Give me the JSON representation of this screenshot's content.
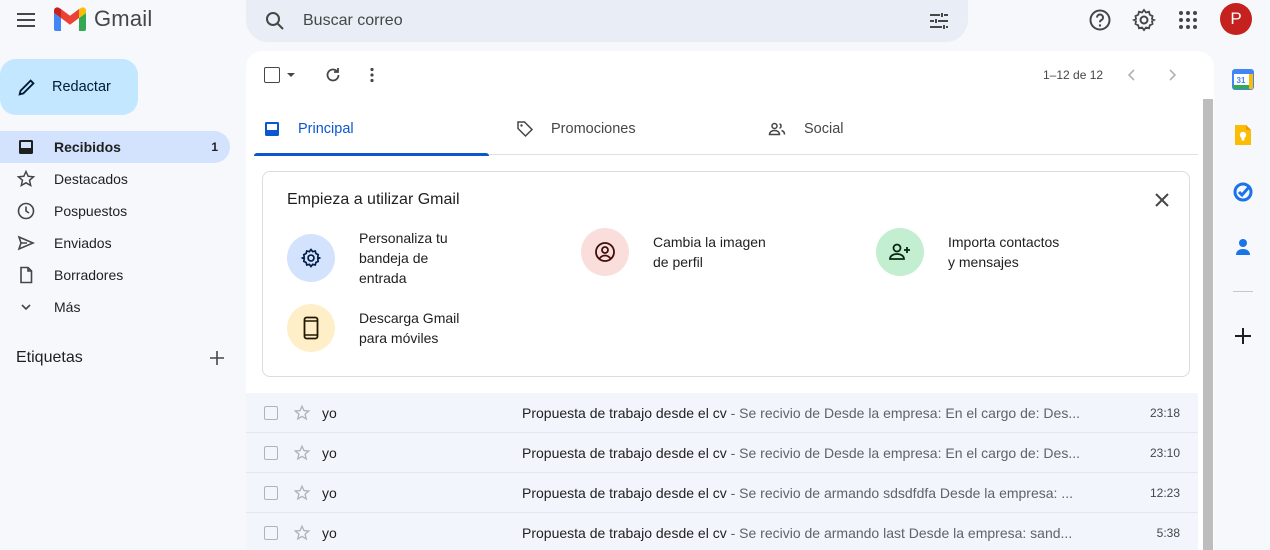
{
  "app": {
    "logo_text": "Gmail"
  },
  "search": {
    "placeholder": "Buscar correo"
  },
  "account": {
    "avatar_letter": "P"
  },
  "compose": {
    "label": "Redactar"
  },
  "nav": {
    "items": [
      {
        "label": "Recibidos",
        "count": "1",
        "icon": "inbox-icon"
      },
      {
        "label": "Destacados",
        "count": "",
        "icon": "star-icon"
      },
      {
        "label": "Pospuestos",
        "count": "",
        "icon": "clock-icon"
      },
      {
        "label": "Enviados",
        "count": "",
        "icon": "send-icon"
      },
      {
        "label": "Borradores",
        "count": "",
        "icon": "draft-icon"
      },
      {
        "label": "Más",
        "count": "",
        "icon": "chevron-down-icon"
      }
    ],
    "labels_title": "Etiquetas"
  },
  "toolbar": {
    "pager": "1–12 de 12"
  },
  "tabs": [
    {
      "label": "Principal",
      "active": true
    },
    {
      "label": "Promociones",
      "active": false
    },
    {
      "label": "Social",
      "active": false
    }
  ],
  "getting_started": {
    "title": "Empieza a utilizar Gmail",
    "tips": [
      {
        "text": "Personaliza tu\nbandeja de\nentrada",
        "icon": "settings-icon",
        "color": "#d3e3fd"
      },
      {
        "text": "Cambia la imagen\nde perfil",
        "icon": "account-circle-icon",
        "color": "#f9dedc"
      },
      {
        "text": "Importa contactos\ny mensajes",
        "icon": "person-add-icon",
        "color": "#c4eed0"
      },
      {
        "text": "Descarga Gmail\npara móviles",
        "icon": "phone-icon",
        "color": "#ffefc9"
      }
    ]
  },
  "emails": [
    {
      "from": "yo",
      "subject": "Propuesta de trabajo desde el cv",
      "snippet": " - Se recivio de Desde la empresa: En el cargo de: Des...",
      "time": "23:18"
    },
    {
      "from": "yo",
      "subject": "Propuesta de trabajo desde el cv",
      "snippet": " - Se recivio de Desde la empresa: En el cargo de: Des...",
      "time": "23:10"
    },
    {
      "from": "yo",
      "subject": "Propuesta de trabajo desde el cv",
      "snippet": " - Se recivio de armando sdsdfdfa Desde la empresa: ...",
      "time": "12:23"
    },
    {
      "from": "yo",
      "subject": "Propuesta de trabajo desde el cv",
      "snippet": " - Se recivio de armando last Desde la empresa: sand...",
      "time": "5:38"
    }
  ],
  "colors": {
    "accent": "#0b57d0",
    "compose_bg": "#c2e7ff",
    "avatar_bg": "#c5221f",
    "nav_active": "#d3e3fd"
  }
}
